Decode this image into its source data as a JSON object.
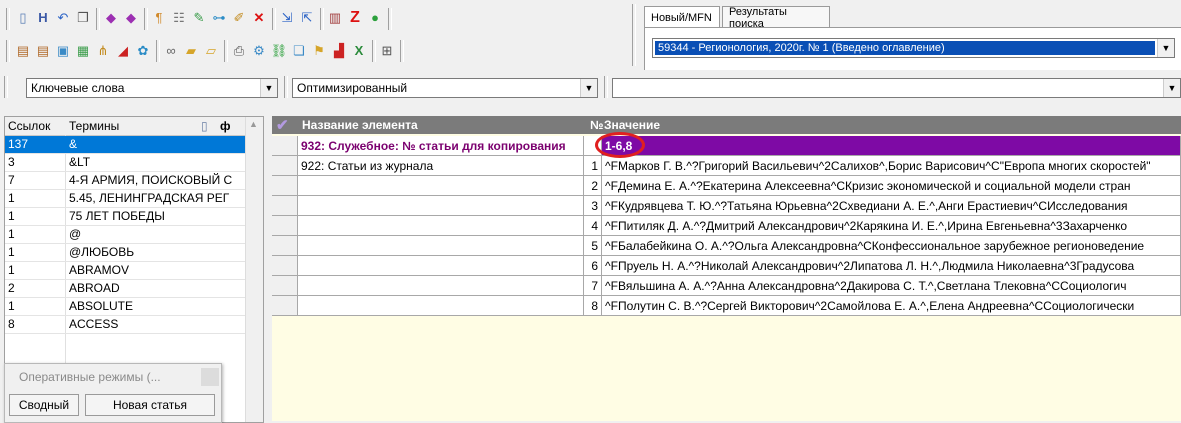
{
  "tabs": [
    "Новый/MFN",
    "Результаты поиска"
  ],
  "record_select": {
    "value": "59344 - Регионология, 2020г. № 1  (Введено оглавление)"
  },
  "search_bar": {
    "field_value": "Ключевые слова",
    "mode_value": "Оптимизированный",
    "query_value": ""
  },
  "terms_list": {
    "headers": {
      "count": "Ссылок",
      "term": "Термины"
    },
    "rows": [
      {
        "count": "137",
        "term": "&",
        "selected": true
      },
      {
        "count": "3",
        "term": "&LT"
      },
      {
        "count": "7",
        "term": "4-Я АРМИЯ, ПОИСКОВЫЙ С"
      },
      {
        "count": "1",
        "term": "5.45, ЛЕНИНГРАДСКАЯ РЕГ"
      },
      {
        "count": "1",
        "term": "75 ЛЕТ ПОБЕДЫ"
      },
      {
        "count": "1",
        "term": "@"
      },
      {
        "count": "1",
        "term": "@ЛЮБОВЬ"
      },
      {
        "count": "1",
        "term": "ABRAMOV"
      },
      {
        "count": "2",
        "term": "ABROAD"
      },
      {
        "count": "1",
        "term": "ABSOLUTE"
      },
      {
        "count": "8",
        "term": "ACCESS"
      }
    ]
  },
  "popup": {
    "title": "Оперативные режимы (...",
    "btn_summary": "Сводный",
    "btn_new": "Новая статья"
  },
  "grid": {
    "headers": {
      "name": "Название элемента",
      "num": "№",
      "value": "Значение"
    },
    "rows": [
      {
        "name": "932: Служебное: № статьи для копирования",
        "num": "",
        "value": "1-6,8",
        "highlight": true
      },
      {
        "name": "922: Статьи из журнала",
        "num": "1",
        "value": "^FМарков Г. В.^?Григорий Васильевич^2Салихов^,Борис Варисович^C\"Европа многих скоростей\""
      },
      {
        "name": "",
        "num": "2",
        "value": "^FДемина Е. А.^?Екатерина Алексеевна^CКризис экономической и социальной модели стран"
      },
      {
        "name": "",
        "num": "3",
        "value": "^FКудрявцева Т. Ю.^?Татьяна Юрьевна^2Схведиани А. Е.^,Анги Ерастиевич^CИсследования"
      },
      {
        "name": "",
        "num": "4",
        "value": "^FПитиляк Д. А.^?Дмитрий Александрович^2Карякина И. Е.^,Ирина Евгеньевна^3Захарченко"
      },
      {
        "name": "",
        "num": "5",
        "value": "^FБалабейкина О. А.^?Ольга Александровна^CКонфессиональное зарубежное регионоведение"
      },
      {
        "name": "",
        "num": "6",
        "value": "^FПруель Н. А.^?Николай Александрович^2Липатова Л. Н.^,Людмила Николаевна^3Градусова"
      },
      {
        "name": "",
        "num": "7",
        "value": "^FВяльшина А. А.^?Анна Александровна^2Дакирова С. Т.^,Светлана Тлековна^CСоциологич"
      },
      {
        "name": "",
        "num": "8",
        "value": "^FПолутин С. В.^?Сергей Викторович^2Самойлова Е. А.^,Елена Андреевна^CСоциологически"
      }
    ]
  },
  "colors": {
    "accent_purple": "#7e0aa5",
    "highlight_text": "#7b006f",
    "selection_blue": "#0078d7",
    "circle_red": "#e02020"
  }
}
